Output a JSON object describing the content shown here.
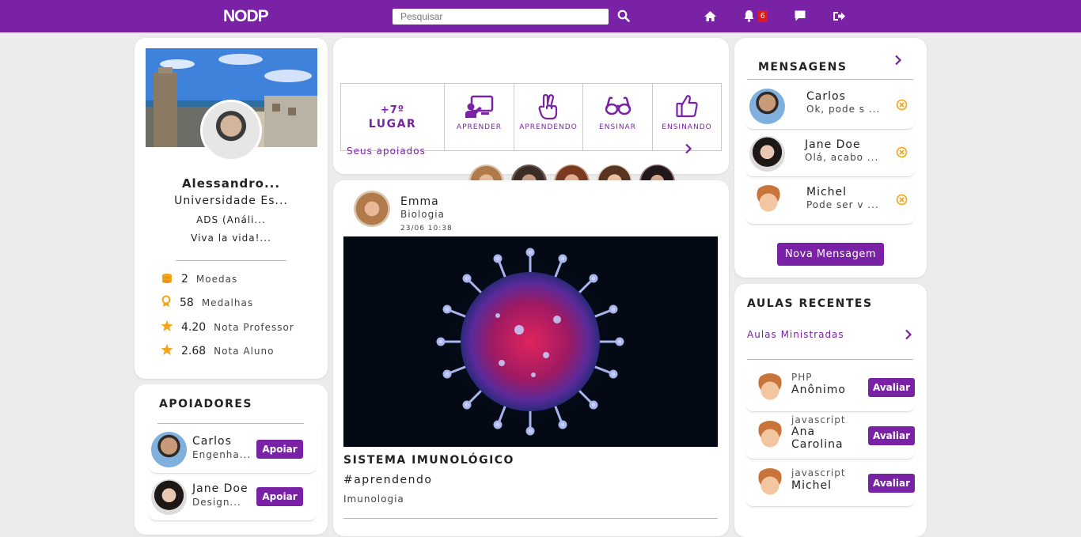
{
  "app": {
    "logo": "NODP"
  },
  "search": {
    "placeholder": "Pesquisar"
  },
  "notifications": {
    "count": "6"
  },
  "colors": {
    "brand": "#7a22a5",
    "badge": "#e0191f",
    "accent_icon": "#f2a51a"
  },
  "profile": {
    "name": "Alessandro...",
    "university": "Universidade Es...",
    "course": "ADS (Análi...",
    "bio": "Viva la vida!...",
    "stats": [
      {
        "icon": "coins-icon",
        "value": "2",
        "label": "Moedas"
      },
      {
        "icon": "medal-icon",
        "value": "58",
        "label": "Medalhas"
      },
      {
        "icon": "star-icon",
        "value": "4.20",
        "label": "Nota Professor"
      },
      {
        "icon": "star-icon",
        "value": "2.68",
        "label": "Nota Aluno"
      }
    ]
  },
  "supporters": {
    "title": "APOIADORES",
    "items": [
      {
        "name": "Carlos",
        "sub": "Engenha...",
        "button": "Apoiar"
      },
      {
        "name": "Jane Doe",
        "sub": "Design...",
        "button": "Apoiar"
      }
    ]
  },
  "ranking": {
    "position": "+7º",
    "label": "LUGAR"
  },
  "actions": [
    {
      "icon": "teacher-board-icon",
      "label": "APRENDER"
    },
    {
      "icon": "hand-peace-icon",
      "label": "APRENDENDO"
    },
    {
      "icon": "glasses-icon",
      "label": "ENSINAR"
    },
    {
      "icon": "thumbs-up-icon",
      "label": "ENSINANDO"
    }
  ],
  "supported": {
    "label": "Seus apoiados"
  },
  "post": {
    "author": "Emma",
    "subject": "Biologia",
    "date": "23/06 10:38",
    "title": "SISTEMA IMUNOLÓGICO",
    "hashtag": "#aprendendo",
    "category": "Imunologia"
  },
  "messages": {
    "title": "MENSAGENS",
    "items": [
      {
        "name": "Carlos",
        "preview": "Ok, pode s ..."
      },
      {
        "name": "Jane Doe",
        "preview": "Olá, acabo ..."
      },
      {
        "name": "Michel",
        "preview": "Pode ser v ..."
      }
    ],
    "new_button": "Nova Mensagem"
  },
  "recent": {
    "title": "AULAS RECENTES",
    "link": "Aulas Ministradas",
    "items": [
      {
        "subject": "PHP",
        "name": "Anônimo",
        "button": "Avaliar"
      },
      {
        "subject": "javascript",
        "name": "Ana Carolina",
        "button": "Avaliar"
      },
      {
        "subject": "javascript",
        "name": "Michel",
        "button": "Avaliar"
      }
    ]
  }
}
